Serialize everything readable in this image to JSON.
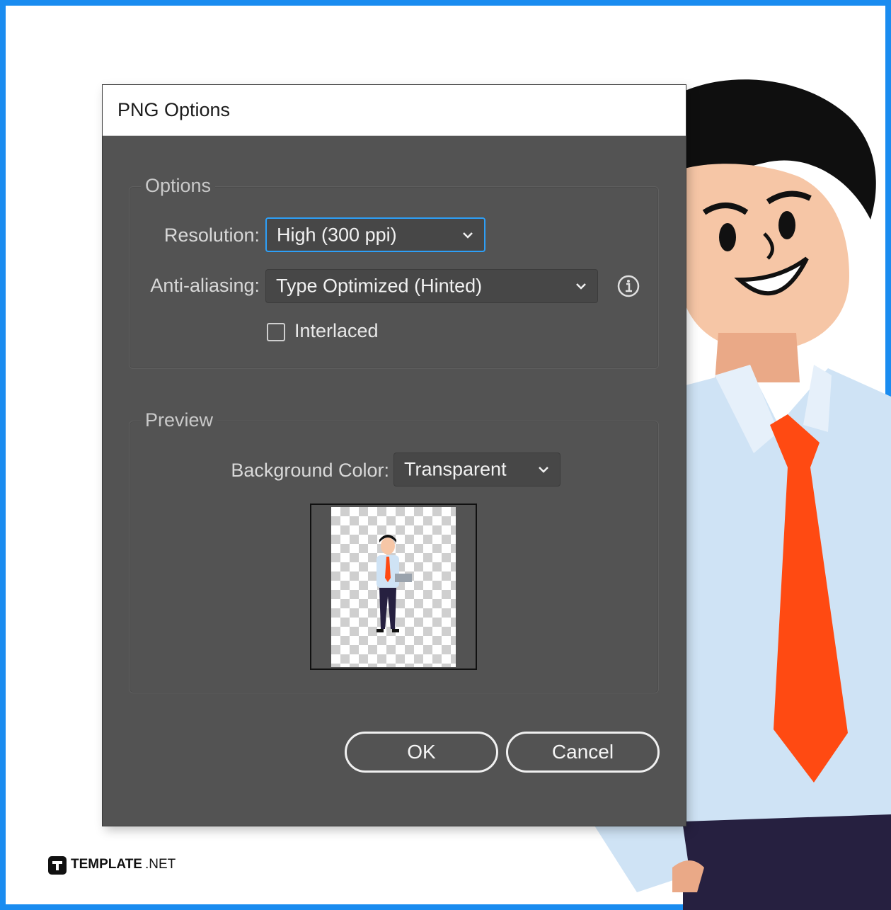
{
  "dialog": {
    "title": "PNG Options",
    "options_group": {
      "legend": "Options",
      "resolution": {
        "label": "Resolution:",
        "value": "High (300 ppi)"
      },
      "anti_aliasing": {
        "label": "Anti-aliasing:",
        "value": "Type Optimized (Hinted)"
      },
      "interlaced": {
        "label": "Interlaced",
        "checked": false
      }
    },
    "preview_group": {
      "legend": "Preview",
      "background_color": {
        "label": "Background Color:",
        "value": "Transparent"
      }
    },
    "buttons": {
      "ok": "OK",
      "cancel": "Cancel"
    }
  },
  "watermark": {
    "brand": "TEMPLATE",
    "suffix": ".NET"
  },
  "colors": {
    "frame": "#1a8cf0",
    "dialog_bg": "#535353",
    "focus": "#2d9ff7",
    "tie": "#ff4a12",
    "shirt": "#cfe3f5",
    "skin": "#f6c6a6"
  },
  "icons": [
    "chevron-down-icon",
    "info-icon",
    "checkbox-icon",
    "template-logo-icon"
  ]
}
